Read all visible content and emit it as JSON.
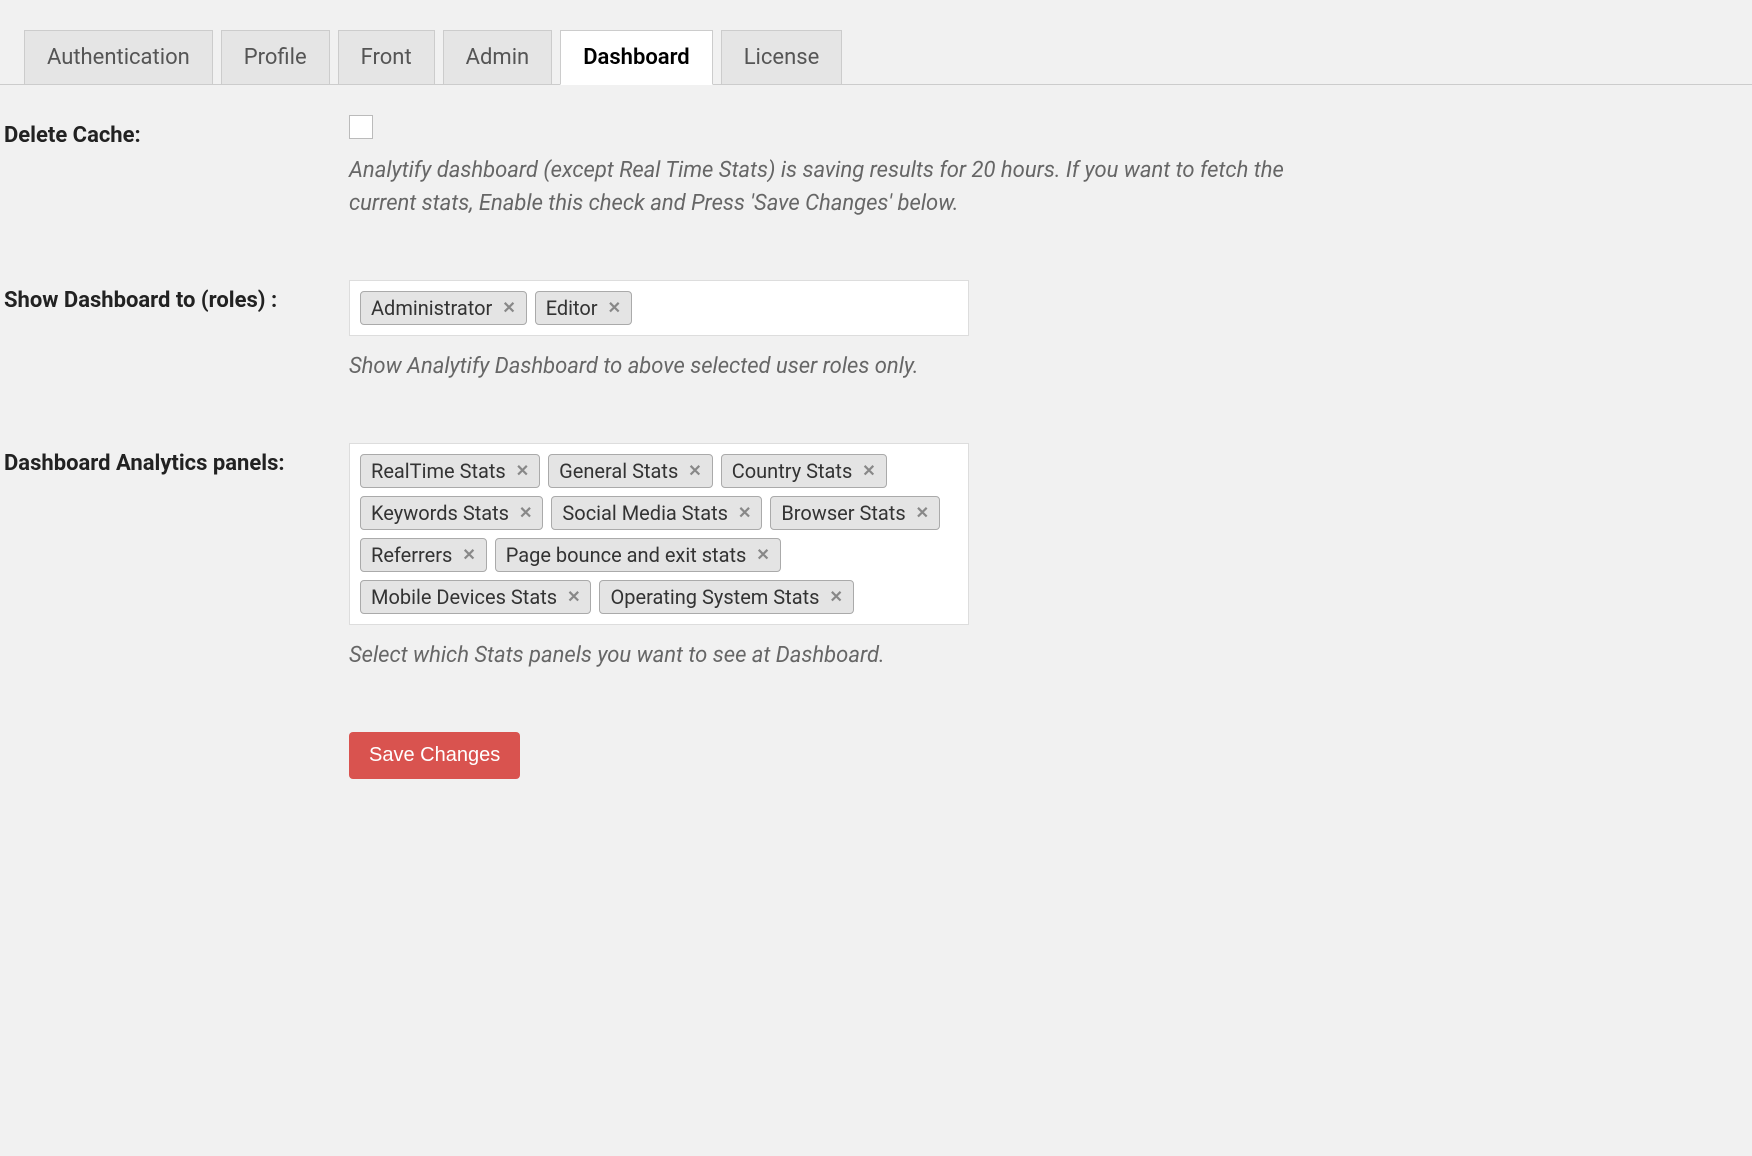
{
  "tabs": {
    "authentication": "Authentication",
    "profile": "Profile",
    "front": "Front",
    "admin": "Admin",
    "dashboard": "Dashboard",
    "license": "License",
    "active": "dashboard"
  },
  "settings": {
    "delete_cache": {
      "label": "Delete Cache:",
      "description": "Analytify dashboard (except Real Time Stats) is saving results for 20 hours. If you want to fetch the current stats, Enable this check and Press 'Save Changes' below."
    },
    "show_roles": {
      "label": "Show Dashboard to (roles) :",
      "description": "Show Analytify Dashboard to above selected user roles only.",
      "tags": [
        "Administrator",
        "Editor"
      ]
    },
    "panels": {
      "label": "Dashboard Analytics panels:",
      "description": "Select which Stats panels you want to see at Dashboard.",
      "tags": [
        "RealTime Stats",
        "General Stats",
        "Country Stats",
        "Keywords Stats",
        "Social Media Stats",
        "Browser Stats",
        "Referrers",
        "Page bounce and exit stats",
        "Mobile Devices Stats",
        "Operating System Stats"
      ]
    }
  },
  "actions": {
    "save": "Save Changes"
  }
}
